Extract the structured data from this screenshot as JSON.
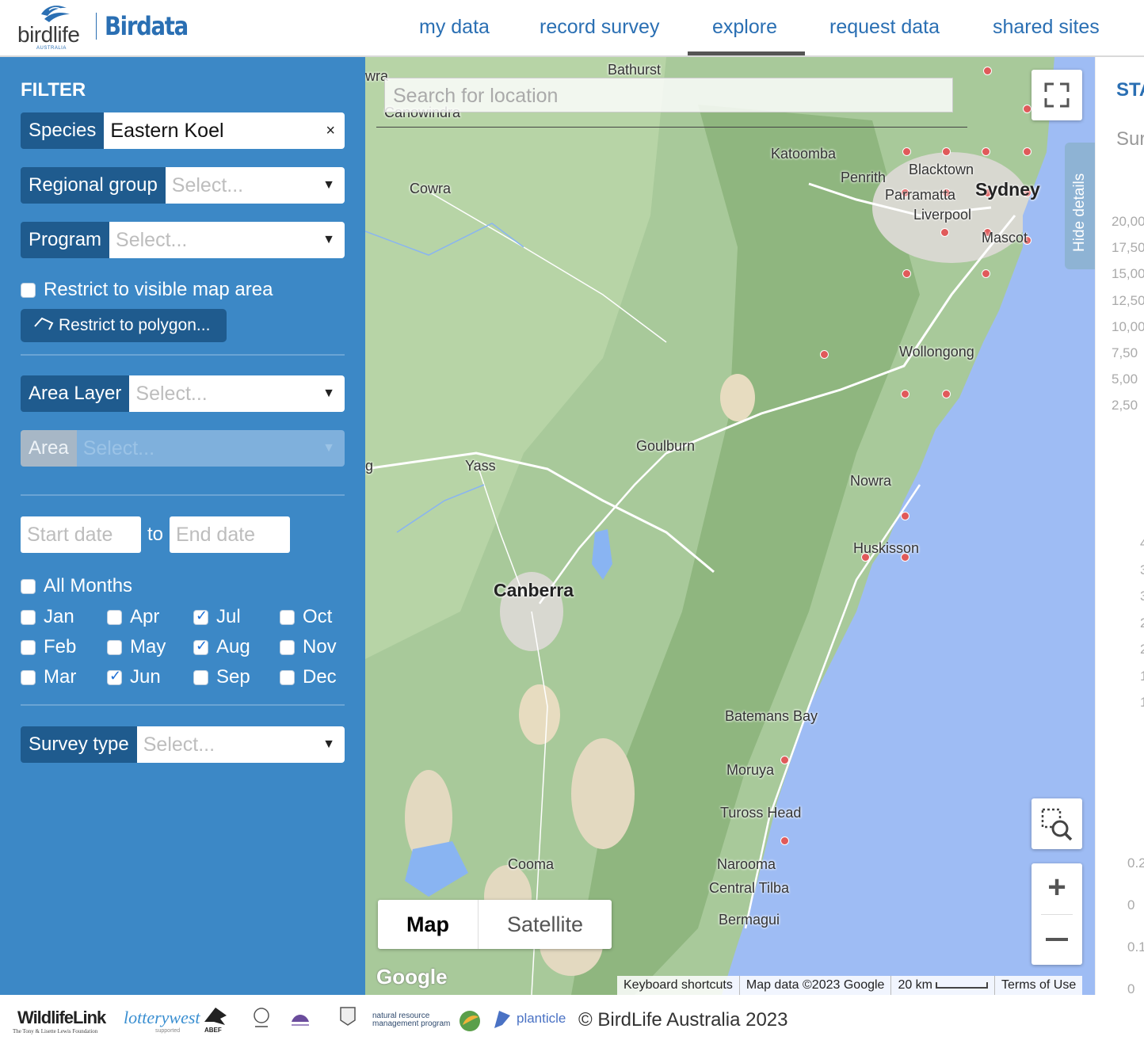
{
  "header": {
    "logo": {
      "word": "birdlife",
      "sub": "AUSTRALIA"
    },
    "app_title": "Birdata",
    "nav": [
      "my data",
      "record survey",
      "explore",
      "request data",
      "shared sites"
    ],
    "active_nav": "explore",
    "accent_color": "#2a6fb3"
  },
  "filter": {
    "title": "FILTER",
    "species": {
      "label": "Species",
      "value": "Eastern Koel"
    },
    "regional_group": {
      "label": "Regional group",
      "placeholder": "Select..."
    },
    "program": {
      "label": "Program",
      "placeholder": "Select..."
    },
    "restrict_visible": {
      "label": "Restrict to visible map area",
      "checked": false
    },
    "restrict_polygon": "Restrict to polygon...",
    "area_layer": {
      "label": "Area Layer",
      "placeholder": "Select..."
    },
    "area": {
      "label": "Area",
      "placeholder": "Select..."
    },
    "start_date": "Start date",
    "to": "to",
    "end_date": "End date",
    "all_months": "All Months",
    "months": [
      {
        "label": "Jan",
        "checked": false
      },
      {
        "label": "Feb",
        "checked": false
      },
      {
        "label": "Mar",
        "checked": false
      },
      {
        "label": "Apr",
        "checked": false
      },
      {
        "label": "May",
        "checked": false
      },
      {
        "label": "Jun",
        "checked": true
      },
      {
        "label": "Jul",
        "checked": true
      },
      {
        "label": "Aug",
        "checked": true
      },
      {
        "label": "Sep",
        "checked": false
      },
      {
        "label": "Oct",
        "checked": false
      },
      {
        "label": "Nov",
        "checked": false
      },
      {
        "label": "Dec",
        "checked": false
      }
    ],
    "survey_type": {
      "label": "Survey type",
      "placeholder": "Select..."
    }
  },
  "map": {
    "search_placeholder": "Search for location",
    "map_type": [
      "Map",
      "Satellite"
    ],
    "hide_details": "Hide details",
    "google": "Google",
    "attribution": {
      "keyboard": "Keyboard shortcuts",
      "data": "Map data ©2023 Google",
      "scale": "20 km",
      "terms": "Terms of Use"
    },
    "places": [
      "Bathurst",
      "Canowindra",
      "Cowra",
      "Katoomba",
      "Penrith",
      "Blacktown",
      "Parramatta",
      "Sydney",
      "Liverpool",
      "Mascot",
      "Wollongong",
      "Goulburn",
      "Yass",
      "Nowra",
      "Huskisson",
      "Canberra",
      "Batemans Bay",
      "Moruya",
      "Tuross Head",
      "Narooma",
      "Central Tilba",
      "Bermagui",
      "Cooma",
      "wra",
      "g"
    ]
  },
  "right_panel": {
    "title": "STA",
    "subtitle": "Sur",
    "ticks_top": [
      "20,00",
      "17,50",
      "15,00",
      "12,50",
      "10,00",
      "7,50",
      "5,00",
      "2,50"
    ],
    "ticks_mid": [
      "4",
      "3",
      "3",
      "2",
      "2",
      "1",
      "1"
    ],
    "ticks_bottom": [
      "0.2",
      "0",
      "0.1",
      "0"
    ]
  },
  "footer": {
    "wildlifelink": "WildlifeLink",
    "wildlifelink_sub": "The Tony & Lisette Lewis Foundation",
    "lotterywest": "lotterywest",
    "lotterywest_sub": "supported",
    "abef": "ABEF",
    "nrm": "natural resource management program",
    "planticle": "planticle",
    "copyright": "© BirdLife Australia 2023"
  }
}
